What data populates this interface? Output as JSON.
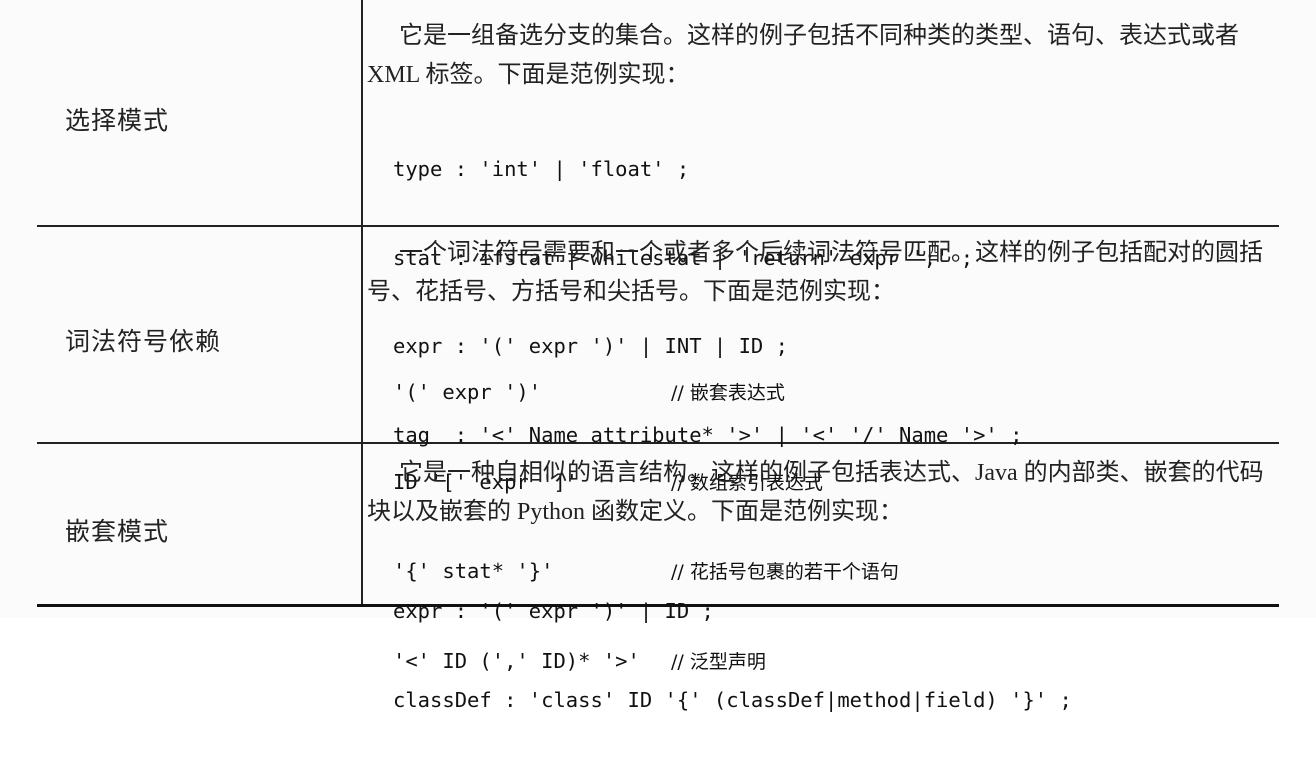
{
  "rows": [
    {
      "label": "选择模式",
      "description": "它是一组备选分支的集合。这样的例子包括不同种类的类型、语句、表达式或者 XML 标签。下面是范例实现：",
      "code": [
        "type : 'int' | 'float' ;",
        "stat : ifstat | whilestat | 'return' expr ';' ;",
        "expr : '(' expr ')' | INT | ID ;",
        "tag  : '<' Name attribute* '>' | '<' '/' Name '>' ;"
      ]
    },
    {
      "label": "词法符号依赖",
      "description": "一个词法符号需要和一个或者多个后续词法符号匹配。这样的例子包括配对的圆括号、花括号、方括号和尖括号。下面是范例实现：",
      "code": [
        {
          "expr": "'(' expr ')'",
          "comment": "// 嵌套表达式"
        },
        {
          "expr": "ID '[' expr ']'",
          "comment": "// 数组索引表达式"
        },
        {
          "expr": "'{' stat* '}'",
          "comment": "// 花括号包裹的若干个语句"
        },
        {
          "expr": "'<' ID (',' ID)* '>'",
          "comment": "// 泛型声明"
        }
      ]
    },
    {
      "label": "嵌套模式",
      "description": "它是一种自相似的语言结构。这样的例子包括表达式、Java 的内部类、嵌套的代码块以及嵌套的 Python 函数定义。下面是范例实现：",
      "code": [
        "expr : '(' expr ')' | ID ;",
        "classDef : 'class' ID '{' (classDef|method|field) '}' ;"
      ]
    }
  ]
}
